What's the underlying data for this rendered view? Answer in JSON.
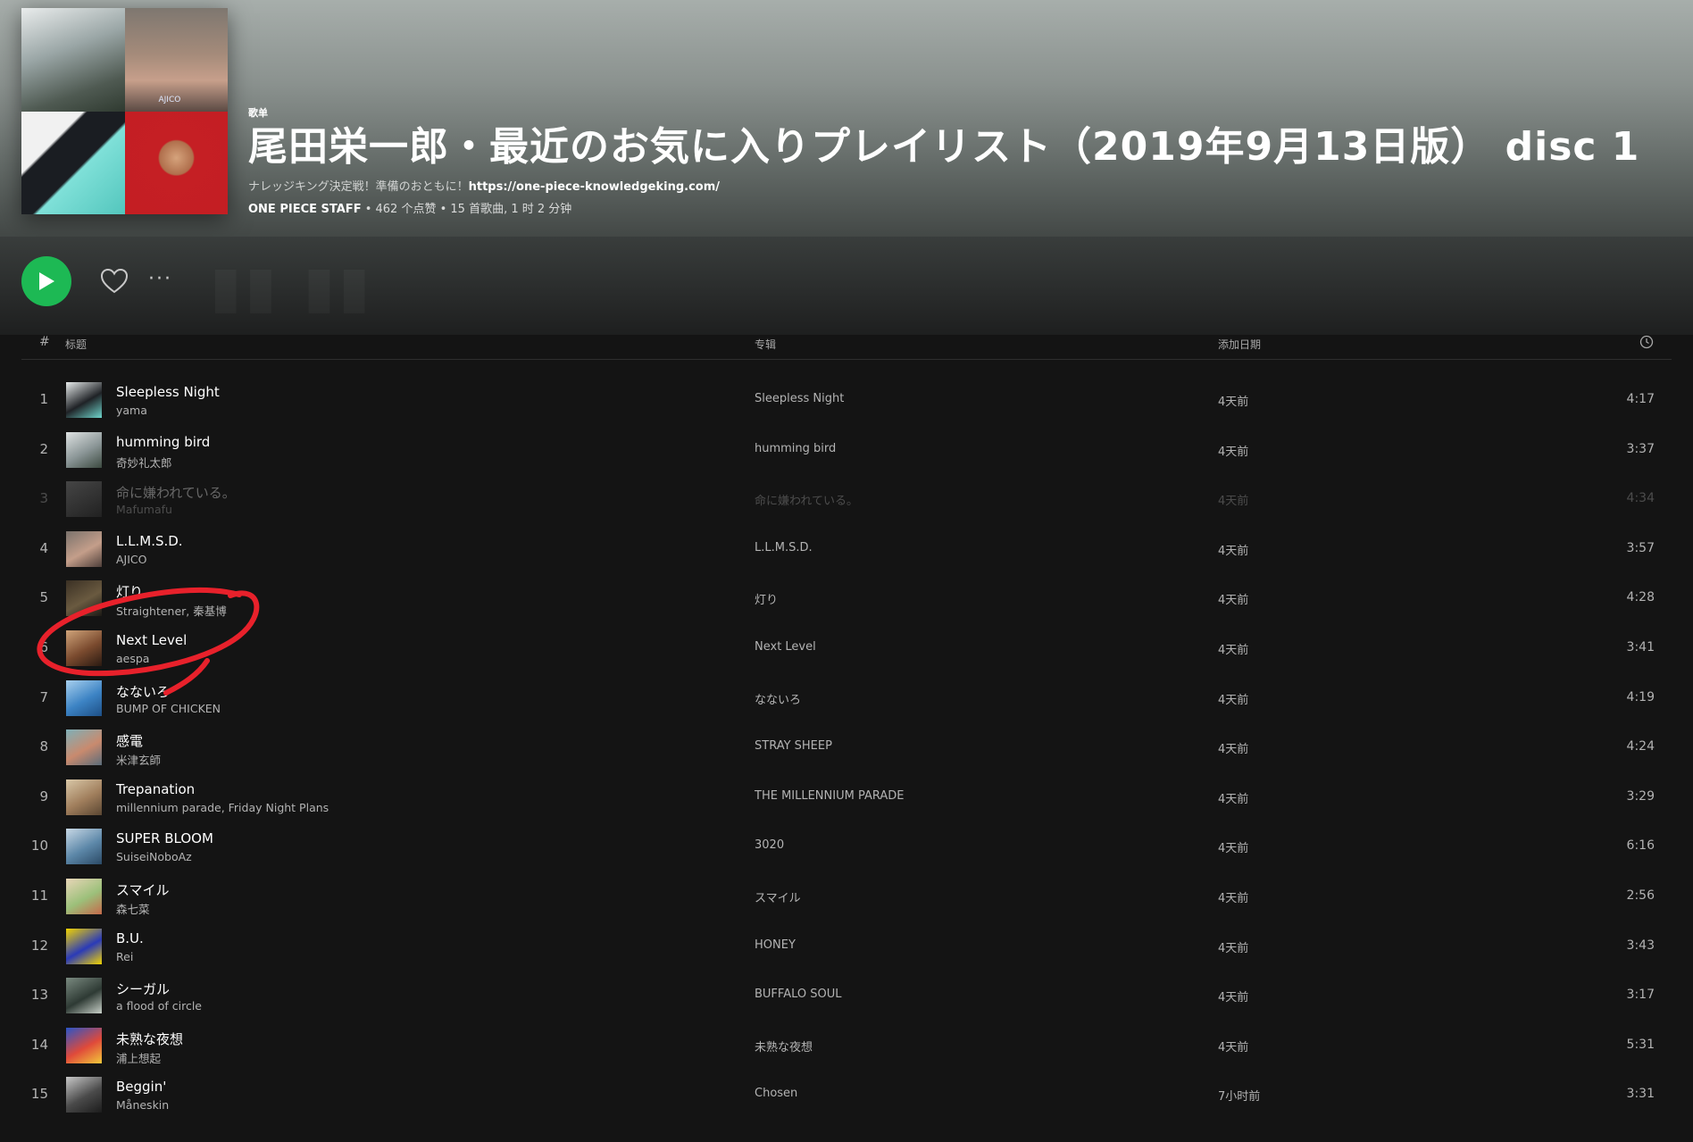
{
  "header": {
    "type_label": "歌单",
    "title": "尾田栄一郎・最近のお気に入りプレイリスト（2019年9月13日版） disc 1",
    "description_prefix": "ナレッジキング決定戦！準備のおともに！",
    "description_link": "https://one-piece-knowledgeking.com/",
    "owner": "ONE PIECE STAFF",
    "stats": " • 462 个点赞 • 15 首歌曲, 1 时 2 分钟",
    "cover_label": "AJICO"
  },
  "actions": {
    "play": "play",
    "like": "heart",
    "more": "···"
  },
  "columns": {
    "num": "#",
    "title": "标题",
    "album": "专辑",
    "added": "添加日期",
    "duration": "clock-icon"
  },
  "tracks": [
    {
      "num": "1",
      "title": "Sleepless Night",
      "artist": "yama",
      "album": "Sleepless Night",
      "added": "4天前",
      "duration": "4:17",
      "thumb": [
        "#e8ecec",
        "#1f2226",
        "#6fd5cc"
      ],
      "dim": false
    },
    {
      "num": "2",
      "title": "humming bird",
      "artist": "奇妙礼太郎",
      "album": "humming bird",
      "added": "4天前",
      "duration": "3:37",
      "thumb": [
        "#dfe3e3",
        "#8a9596",
        "#3c4a40"
      ],
      "dim": false
    },
    {
      "num": "3",
      "title": "命に嫌われている。",
      "artist": "Mafumafu",
      "album": "命に嫌われている。",
      "added": "4天前",
      "duration": "4:34",
      "thumb": [
        "#a1a1a1",
        "#6a6a6a",
        "#3a3a3a"
      ],
      "dim": true
    },
    {
      "num": "4",
      "title": "L.L.M.S.D.",
      "artist": "AJICO",
      "album": "L.L.M.S.D.",
      "added": "4天前",
      "duration": "3:57",
      "thumb": [
        "#7a726c",
        "#c49e8a",
        "#4e3f3a"
      ],
      "dim": false
    },
    {
      "num": "5",
      "title": "灯り",
      "artist": "Straightener, 秦基博",
      "album": "灯り",
      "added": "4天前",
      "duration": "4:28",
      "thumb": [
        "#3a3024",
        "#6a5a40",
        "#1c1a16"
      ],
      "dim": false
    },
    {
      "num": "6",
      "title": "Next Level",
      "artist": "aespa",
      "album": "Next Level",
      "added": "4天前",
      "duration": "3:41",
      "thumb": [
        "#d0a47a",
        "#7a4a2e",
        "#2a1a12"
      ],
      "dim": false
    },
    {
      "num": "7",
      "title": "なないろ",
      "artist": "BUMP OF CHICKEN",
      "album": "なないろ",
      "added": "4天前",
      "duration": "4:19",
      "thumb": [
        "#a8d0ee",
        "#3c83c4",
        "#1d4f86"
      ],
      "dim": false
    },
    {
      "num": "8",
      "title": "感電",
      "artist": "米津玄師",
      "album": "STRAY SHEEP",
      "added": "4天前",
      "duration": "4:24",
      "thumb": [
        "#7fb0b8",
        "#c98a6e",
        "#5a6c7a"
      ],
      "dim": false
    },
    {
      "num": "9",
      "title": "Trepanation",
      "artist": "millennium parade, Friday Night Plans",
      "album": "THE MILLENNIUM PARADE",
      "added": "4天前",
      "duration": "3:29",
      "thumb": [
        "#d9c8a8",
        "#a07e5c",
        "#5a4632"
      ],
      "dim": false
    },
    {
      "num": "10",
      "title": "SUPER BLOOM",
      "artist": "SuiseiNoboAz",
      "album": "3020",
      "added": "4天前",
      "duration": "6:16",
      "thumb": [
        "#c9d9e6",
        "#5c87a8",
        "#2b4a66"
      ],
      "dim": false
    },
    {
      "num": "11",
      "title": "スマイル",
      "artist": "森七菜",
      "album": "スマイル",
      "added": "4天前",
      "duration": "2:56",
      "thumb": [
        "#e9d6b8",
        "#9cc07a",
        "#c56a4a"
      ],
      "dim": false
    },
    {
      "num": "12",
      "title": "B.U.",
      "artist": "Rei",
      "album": "HONEY",
      "added": "4天前",
      "duration": "3:43",
      "thumb": [
        "#f2d400",
        "#2a3ab8",
        "#f2d400"
      ],
      "dim": false
    },
    {
      "num": "13",
      "title": "シーガル",
      "artist": "a flood of circle",
      "album": "BUFFALO SOUL",
      "added": "4天前",
      "duration": "3:17",
      "thumb": [
        "#7a8a80",
        "#2e3a34",
        "#c8d0c8"
      ],
      "dim": false
    },
    {
      "num": "14",
      "title": "未熟な夜想",
      "artist": "浦上想起",
      "album": "未熟な夜想",
      "added": "4天前",
      "duration": "5:31",
      "thumb": [
        "#2a55c8",
        "#e04a3a",
        "#f2c93a"
      ],
      "dim": false
    },
    {
      "num": "15",
      "title": "Beggin'",
      "artist": "Måneskin",
      "album": "Chosen",
      "added": "7小时前",
      "duration": "3:31",
      "thumb": [
        "#c8c8c8",
        "#4a4a4a",
        "#1c1c1c"
      ],
      "dim": false
    }
  ],
  "colors": {
    "accent": "#1db954",
    "annotation": "#e8212b"
  }
}
